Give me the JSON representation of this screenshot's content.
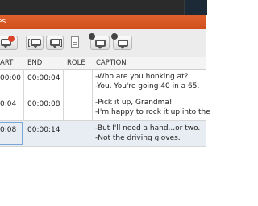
{
  "window": {
    "title_fragment": "es"
  },
  "toolbar": {
    "buttons": [
      {
        "icon": "caption-remove-icon"
      },
      {
        "icon": "caption-insert-before-icon"
      },
      {
        "icon": "caption-insert-after-icon"
      },
      {
        "icon": "document-icon"
      },
      {
        "icon": "caption-time-icon"
      },
      {
        "icon": "caption-time-adjust-icon"
      }
    ]
  },
  "table": {
    "columns": [
      "ART",
      "END",
      "ROLE",
      "CAPTION"
    ],
    "rows": [
      {
        "start": "00:00",
        "end": "00:00:04",
        "role": "",
        "caption_lines": [
          "-Who are you honking at?",
          "-You. You're going 40 in a 65."
        ]
      },
      {
        "start": "0:04",
        "end": "00:00:08",
        "role": "",
        "caption_lines": [
          "-Pick it up, Grandma!",
          "-I'm happy to rock it up into the"
        ]
      },
      {
        "start": "0:08",
        "end": "00:00:14",
        "role": "",
        "caption_lines": [
          "-But I'll need a hand...or two.",
          "-Not the driving gloves."
        ]
      }
    ],
    "selected_row": 2
  }
}
